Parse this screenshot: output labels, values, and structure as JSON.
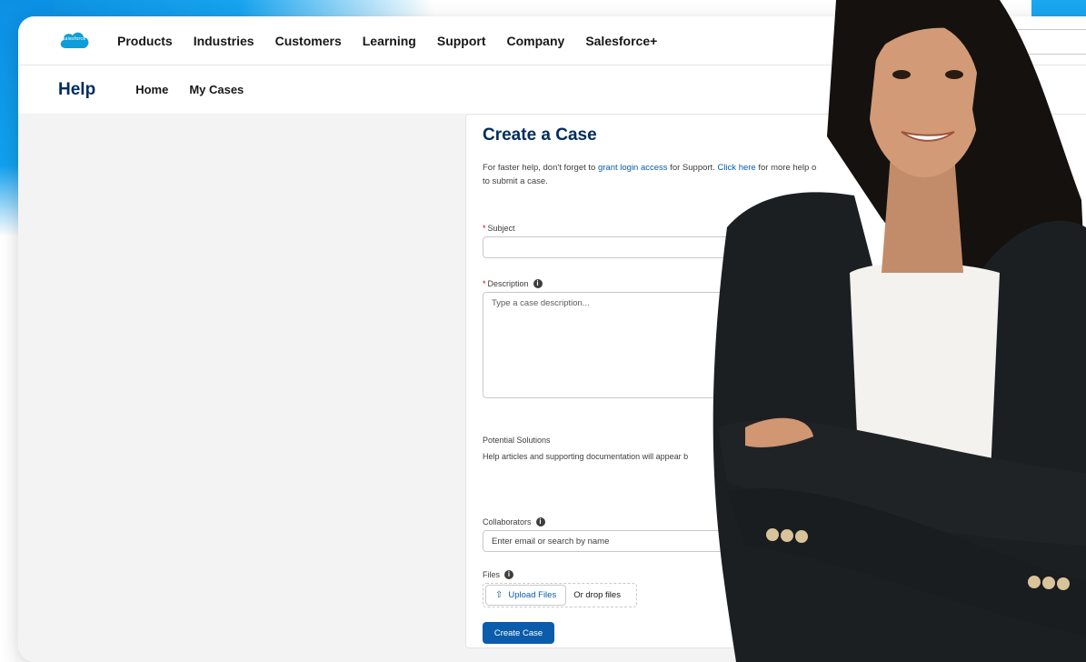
{
  "brand": {
    "logo_text": "salesforce",
    "accent": "#0b5cab",
    "title_color": "#032d60"
  },
  "topnav": {
    "items": [
      "Products",
      "Industries",
      "Customers",
      "Learning",
      "Support",
      "Company",
      "Salesforce+"
    ]
  },
  "subnav": {
    "title": "Help",
    "items": [
      "Home",
      "My Cases"
    ]
  },
  "case_form": {
    "title": "Create a Case",
    "intro_prefix": "For faster help, don't forget to ",
    "intro_link1": "grant login access",
    "intro_middle": " for Support. ",
    "intro_link2": "Click here",
    "intro_suffix": " for more help o",
    "intro_line2": "to submit a case.",
    "required_mark": "*",
    "subject_label": "Subject",
    "subject_value": "",
    "description_label": "Description",
    "description_placeholder": "Type a case description...",
    "potential_solutions_title": "Potential Solutions",
    "potential_solutions_text": "Help articles and supporting documentation will appear b",
    "collaborators_label": "Collaborators",
    "collaborators_placeholder": "Enter email or search by name",
    "files_label": "Files",
    "upload_label": "Upload Files",
    "drop_label": "Or drop files",
    "submit_label": "Create Case"
  },
  "icons": {
    "info": "info-icon",
    "upload": "upload-icon",
    "info_glyph": "i",
    "upload_glyph": "⇧"
  }
}
